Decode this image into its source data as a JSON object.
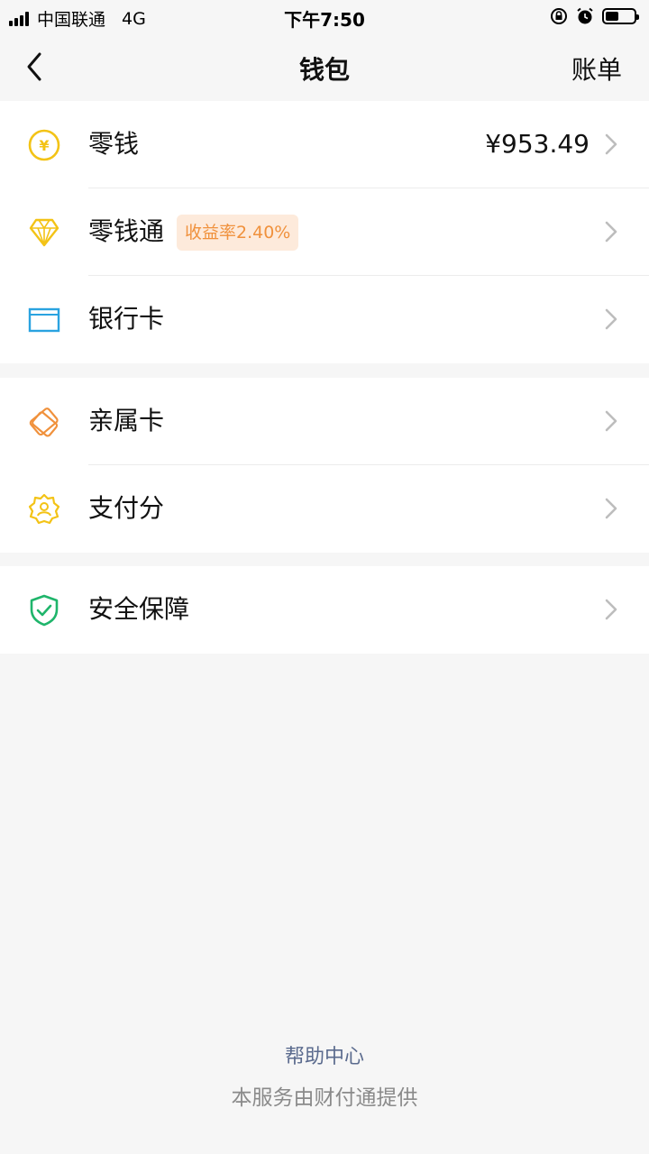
{
  "status": {
    "carrier": "中国联通",
    "network": "4G",
    "time": "下午7:50",
    "battery_level": 0.45
  },
  "nav": {
    "title": "钱包",
    "right_label": "账单"
  },
  "groups": [
    {
      "items": [
        {
          "label": "零钱",
          "value": "¥953.49",
          "icon": "yuan-coin-icon"
        },
        {
          "label": "零钱通",
          "badge": "收益率2.40%",
          "icon": "diamond-icon"
        },
        {
          "label": "银行卡",
          "icon": "bank-card-icon"
        }
      ]
    },
    {
      "items": [
        {
          "label": "亲属卡",
          "icon": "family-card-icon"
        },
        {
          "label": "支付分",
          "icon": "pay-score-icon"
        }
      ]
    },
    {
      "items": [
        {
          "label": "安全保障",
          "icon": "shield-check-icon"
        }
      ]
    }
  ],
  "footer": {
    "help_link": "帮助中心",
    "provider_text": "本服务由财付通提供"
  },
  "colors": {
    "coin": "#f3c316",
    "card": "#2aa3e0",
    "family": "#f0913c",
    "score": "#f3c316",
    "shield": "#1fb56b",
    "badge_bg": "#fdeadb",
    "badge_text": "#f0913c"
  }
}
